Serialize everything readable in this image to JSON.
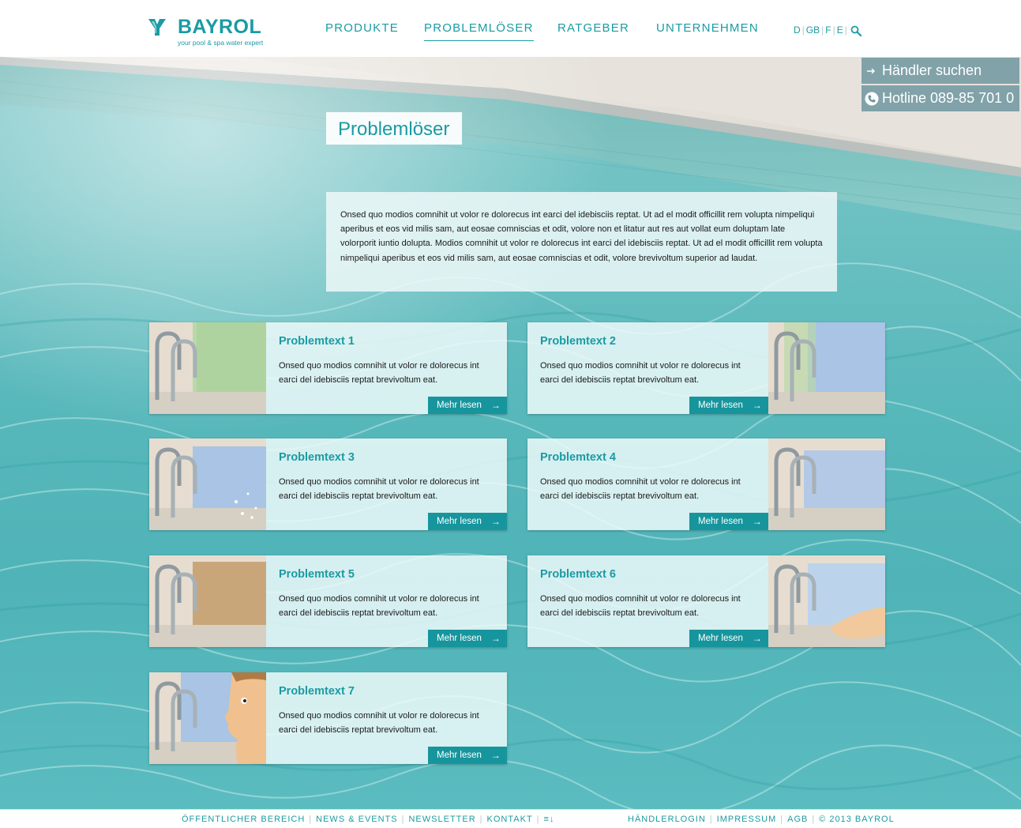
{
  "brand": {
    "name": "BAYROL",
    "tagline": "your pool & spa water expert",
    "color": "#1a9ba3"
  },
  "nav": {
    "items": [
      {
        "label": "PRODUKTE",
        "active": false
      },
      {
        "label": "PROBLEMLÖSER",
        "active": true
      },
      {
        "label": "RATGEBER",
        "active": false
      },
      {
        "label": "UNTERNEHMEN",
        "active": false
      }
    ],
    "languages": [
      "D",
      "GB",
      "F",
      "E"
    ],
    "search_icon": "search-icon"
  },
  "side": {
    "dealer_label": "Händler suchen",
    "hotline_label": "Hotline 089-85 701 0"
  },
  "page": {
    "title": "Problemlöser",
    "intro": "Onsed quo modios comnihit ut volor re dolorecus int earci del idebisciis reptat. Ut ad el modit officillit rem volupta nimpeliqui aperibus et eos vid milis sam, aut eosae comniscias et odit, volore non et litatur aut res aut vollat eum doluptam late volorporit iuntio dolupta. Modios comnihit ut volor re dolorecus int earci del idebisciis reptat. Ut ad el modit officillit rem volupta nimpeliqui aperibus et eos vid milis sam, aut eosae comniscias et odit, volore brevivoltum superior ad laudat."
  },
  "cards": [
    {
      "title": "Problemtext 1",
      "text": "Onsed quo modios comnihit ut volor re dolorecus int earci del idebisciis reptat brevivoltum eat.",
      "button": "Mehr lesen"
    },
    {
      "title": "Problemtext 2",
      "text": "Onsed quo modios comnihit ut volor re dolorecus int earci del idebisciis reptat brevivoltum eat.",
      "button": "Mehr lesen"
    },
    {
      "title": "Problemtext 3",
      "text": "Onsed quo modios comnihit ut volor re dolorecus int earci del idebisciis reptat brevivoltum eat.",
      "button": "Mehr lesen"
    },
    {
      "title": "Problemtext 4",
      "text": "Onsed quo modios comnihit ut volor re dolorecus int earci del idebisciis reptat brevivoltum eat.",
      "button": "Mehr lesen"
    },
    {
      "title": "Problemtext 5",
      "text": "Onsed quo modios comnihit ut volor re dolorecus int earci del idebisciis reptat brevivoltum eat.",
      "button": "Mehr lesen"
    },
    {
      "title": "Problemtext 6",
      "text": "Onsed quo modios comnihit ut volor re dolorecus int earci del idebisciis reptat brevivoltum eat.",
      "button": "Mehr lesen"
    },
    {
      "title": "Problemtext 7",
      "text": "Onsed quo modios comnihit ut volor re dolorecus int earci del idebisciis reptat brevivoltum eat.",
      "button": "Mehr lesen"
    }
  ],
  "footer": {
    "left": [
      "ÖFFENTLICHER BEREICH",
      "NEWS & EVENTS",
      "NEWSLETTER",
      "KONTAKT"
    ],
    "menu_icon": "menu-download-icon",
    "right": [
      "HÄNDLERLOGIN",
      "IMPRESSUM",
      "AGB",
      "© 2013 BAYROL"
    ]
  }
}
